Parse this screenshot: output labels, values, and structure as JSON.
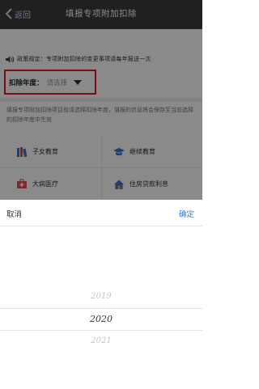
{
  "navbar": {
    "back_label": "返回",
    "title": "填报专项附加扣除"
  },
  "notice": {
    "icon": "speaker-icon",
    "text": "政策规定：专项附加扣除的变更事项请每年报送一次"
  },
  "year_selector": {
    "label": "扣除年度：",
    "placeholder": "请选择",
    "highlight_color": "#e02020"
  },
  "intro_text": "填报专项附加扣除项目前请选择扣除年度，填报的信息将会保存至当前选择的扣除年度中生效",
  "categories": [
    {
      "label": "子女教育",
      "icon": "books-icon"
    },
    {
      "label": "继续教育",
      "icon": "graduation-cap-icon"
    },
    {
      "label": "大病医疗",
      "icon": "medical-kit-icon"
    },
    {
      "label": "住房贷款利息",
      "icon": "house-loan-icon"
    }
  ],
  "picker": {
    "cancel_label": "取消",
    "confirm_label": "确定",
    "confirm_color": "#2b7bd8",
    "years": [
      "2019",
      "2020",
      "2021"
    ],
    "selected": "2020"
  }
}
